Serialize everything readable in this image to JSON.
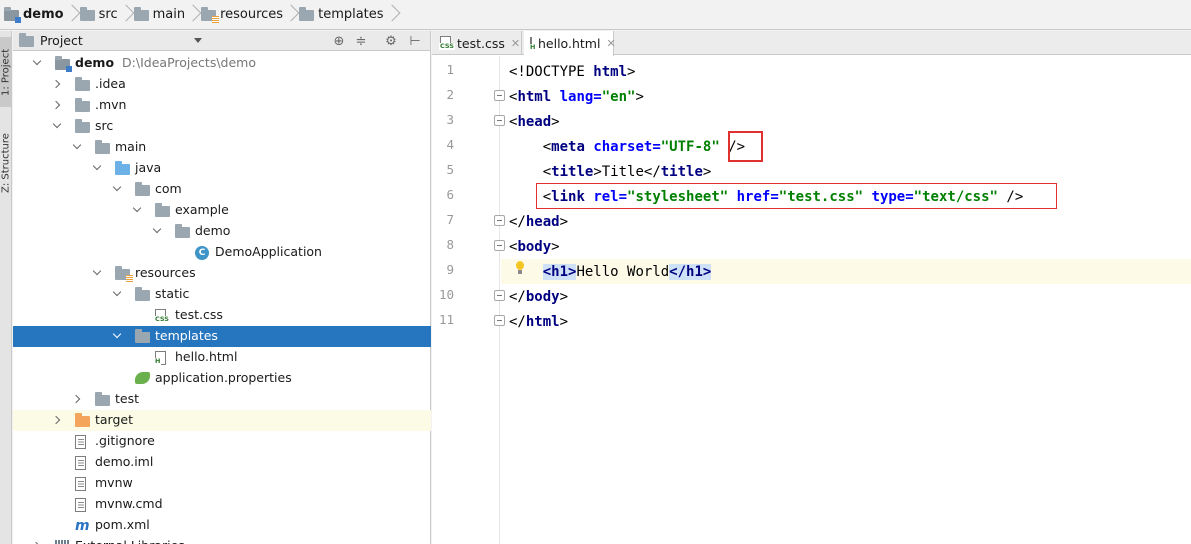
{
  "breadcrumb": [
    {
      "label": "demo",
      "icon": "module-folder-icon",
      "bold": true
    },
    {
      "label": "src",
      "icon": "folder-icon"
    },
    {
      "label": "main",
      "icon": "folder-icon"
    },
    {
      "label": "resources",
      "icon": "resources-folder-icon"
    },
    {
      "label": "templates",
      "icon": "folder-icon"
    }
  ],
  "side_tabs": {
    "project": "1: Project",
    "structure": "Z: Structure"
  },
  "project_panel": {
    "title": "Project",
    "tree": [
      {
        "label": "demo",
        "path": "D:\\IdeaProjects\\demo",
        "depth": 0,
        "expand": "down",
        "icon": "module-folder"
      },
      {
        "label": ".idea",
        "depth": 1,
        "expand": "right",
        "icon": "folder"
      },
      {
        "label": ".mvn",
        "depth": 1,
        "expand": "right",
        "icon": "folder"
      },
      {
        "label": "src",
        "depth": 1,
        "expand": "down",
        "icon": "folder"
      },
      {
        "label": "main",
        "depth": 2,
        "expand": "down",
        "icon": "folder"
      },
      {
        "label": "java",
        "depth": 3,
        "expand": "down",
        "icon": "blue-folder"
      },
      {
        "label": "com",
        "depth": 4,
        "expand": "down",
        "icon": "folder"
      },
      {
        "label": "example",
        "depth": 5,
        "expand": "down",
        "icon": "folder"
      },
      {
        "label": "demo",
        "depth": 6,
        "expand": "down",
        "icon": "folder"
      },
      {
        "label": "DemoApplication",
        "depth": 7,
        "expand": "none",
        "icon": "class"
      },
      {
        "label": "resources",
        "depth": 3,
        "expand": "down",
        "icon": "resources-folder"
      },
      {
        "label": "static",
        "depth": 4,
        "expand": "down",
        "icon": "folder"
      },
      {
        "label": "test.css",
        "depth": 5,
        "expand": "none",
        "icon": "css-file"
      },
      {
        "label": "templates",
        "depth": 4,
        "expand": "down",
        "icon": "folder",
        "selected": true
      },
      {
        "label": "hello.html",
        "depth": 5,
        "expand": "none",
        "icon": "html-file"
      },
      {
        "label": "application.properties",
        "depth": 4,
        "expand": "none",
        "icon": "spring-leaf"
      },
      {
        "label": "test",
        "depth": 2,
        "expand": "right",
        "icon": "folder"
      },
      {
        "label": "target",
        "depth": 1,
        "expand": "right",
        "icon": "orange-folder",
        "highlight": true
      },
      {
        "label": ".gitignore",
        "depth": 1,
        "expand": "none",
        "icon": "text-file"
      },
      {
        "label": "demo.iml",
        "depth": 1,
        "expand": "none",
        "icon": "text-file"
      },
      {
        "label": "mvnw",
        "depth": 1,
        "expand": "none",
        "icon": "text-file"
      },
      {
        "label": "mvnw.cmd",
        "depth": 1,
        "expand": "none",
        "icon": "text-file"
      },
      {
        "label": "pom.xml",
        "depth": 1,
        "expand": "none",
        "icon": "maven-m"
      },
      {
        "label": "External Libraries",
        "depth": 0,
        "expand": "right",
        "icon": "library"
      }
    ]
  },
  "editor": {
    "tabs": [
      {
        "label": "test.css",
        "icon": "css-file",
        "active": false
      },
      {
        "label": "hello.html",
        "icon": "html-file",
        "active": true
      }
    ],
    "line_numbers": [
      "1",
      "2",
      "3",
      "4",
      "5",
      "6",
      "7",
      "8",
      "9",
      "10",
      "11"
    ],
    "current_line": 9,
    "lines": [
      [
        {
          "t": "<!DOCTYPE ",
          "c": "pl"
        },
        {
          "t": "html",
          "c": "tg"
        },
        {
          "t": ">",
          "c": "pl"
        }
      ],
      [
        {
          "t": "<",
          "c": "pl"
        },
        {
          "t": "html ",
          "c": "tg"
        },
        {
          "t": "lang=",
          "c": "at"
        },
        {
          "t": "\"en\"",
          "c": "st"
        },
        {
          "t": ">",
          "c": "pl"
        }
      ],
      [
        {
          "t": "<",
          "c": "pl"
        },
        {
          "t": "head",
          "c": "tg"
        },
        {
          "t": ">",
          "c": "pl"
        }
      ],
      [
        {
          "t": "    <",
          "c": "pl"
        },
        {
          "t": "meta ",
          "c": "tg"
        },
        {
          "t": "charset=",
          "c": "at"
        },
        {
          "t": "\"UTF-8\"",
          "c": "st"
        },
        {
          "t": " />",
          "c": "pl"
        }
      ],
      [
        {
          "t": "    <",
          "c": "pl"
        },
        {
          "t": "title",
          "c": "tg"
        },
        {
          "t": ">Title</",
          "c": "pl"
        },
        {
          "t": "title",
          "c": "tg"
        },
        {
          "t": ">",
          "c": "pl"
        }
      ],
      [
        {
          "t": "    <",
          "c": "pl"
        },
        {
          "t": "link ",
          "c": "tg"
        },
        {
          "t": "rel=",
          "c": "at"
        },
        {
          "t": "\"stylesheet\"",
          "c": "st"
        },
        {
          "t": " ",
          "c": "pl"
        },
        {
          "t": "href=",
          "c": "at"
        },
        {
          "t": "\"test.css\"",
          "c": "st"
        },
        {
          "t": " ",
          "c": "pl"
        },
        {
          "t": "type=",
          "c": "at"
        },
        {
          "t": "\"text/css\"",
          "c": "st"
        },
        {
          "t": " />",
          "c": "pl"
        }
      ],
      [
        {
          "t": "</",
          "c": "pl"
        },
        {
          "t": "head",
          "c": "tg"
        },
        {
          "t": ">",
          "c": "pl"
        }
      ],
      [
        {
          "t": "<",
          "c": "pl"
        },
        {
          "t": "body",
          "c": "tg"
        },
        {
          "t": ">",
          "c": "pl"
        }
      ],
      [
        {
          "t": "    ",
          "c": "pl"
        },
        {
          "t": "<h1>",
          "c": "hl"
        },
        {
          "t": "Hello World",
          "c": "pl"
        },
        {
          "t": "</h1>",
          "c": "hl"
        }
      ],
      [
        {
          "t": "</",
          "c": "pl"
        },
        {
          "t": "body",
          "c": "tg"
        },
        {
          "t": ">",
          "c": "pl"
        }
      ],
      [
        {
          "t": "</",
          "c": "pl"
        },
        {
          "t": "html",
          "c": "tg"
        },
        {
          "t": ">",
          "c": "pl"
        }
      ]
    ]
  },
  "colors": {
    "selection": "#2675bf",
    "tag": "#000080",
    "attribute": "#0000ff",
    "string": "#008000",
    "annotation_box": "#e03030"
  }
}
